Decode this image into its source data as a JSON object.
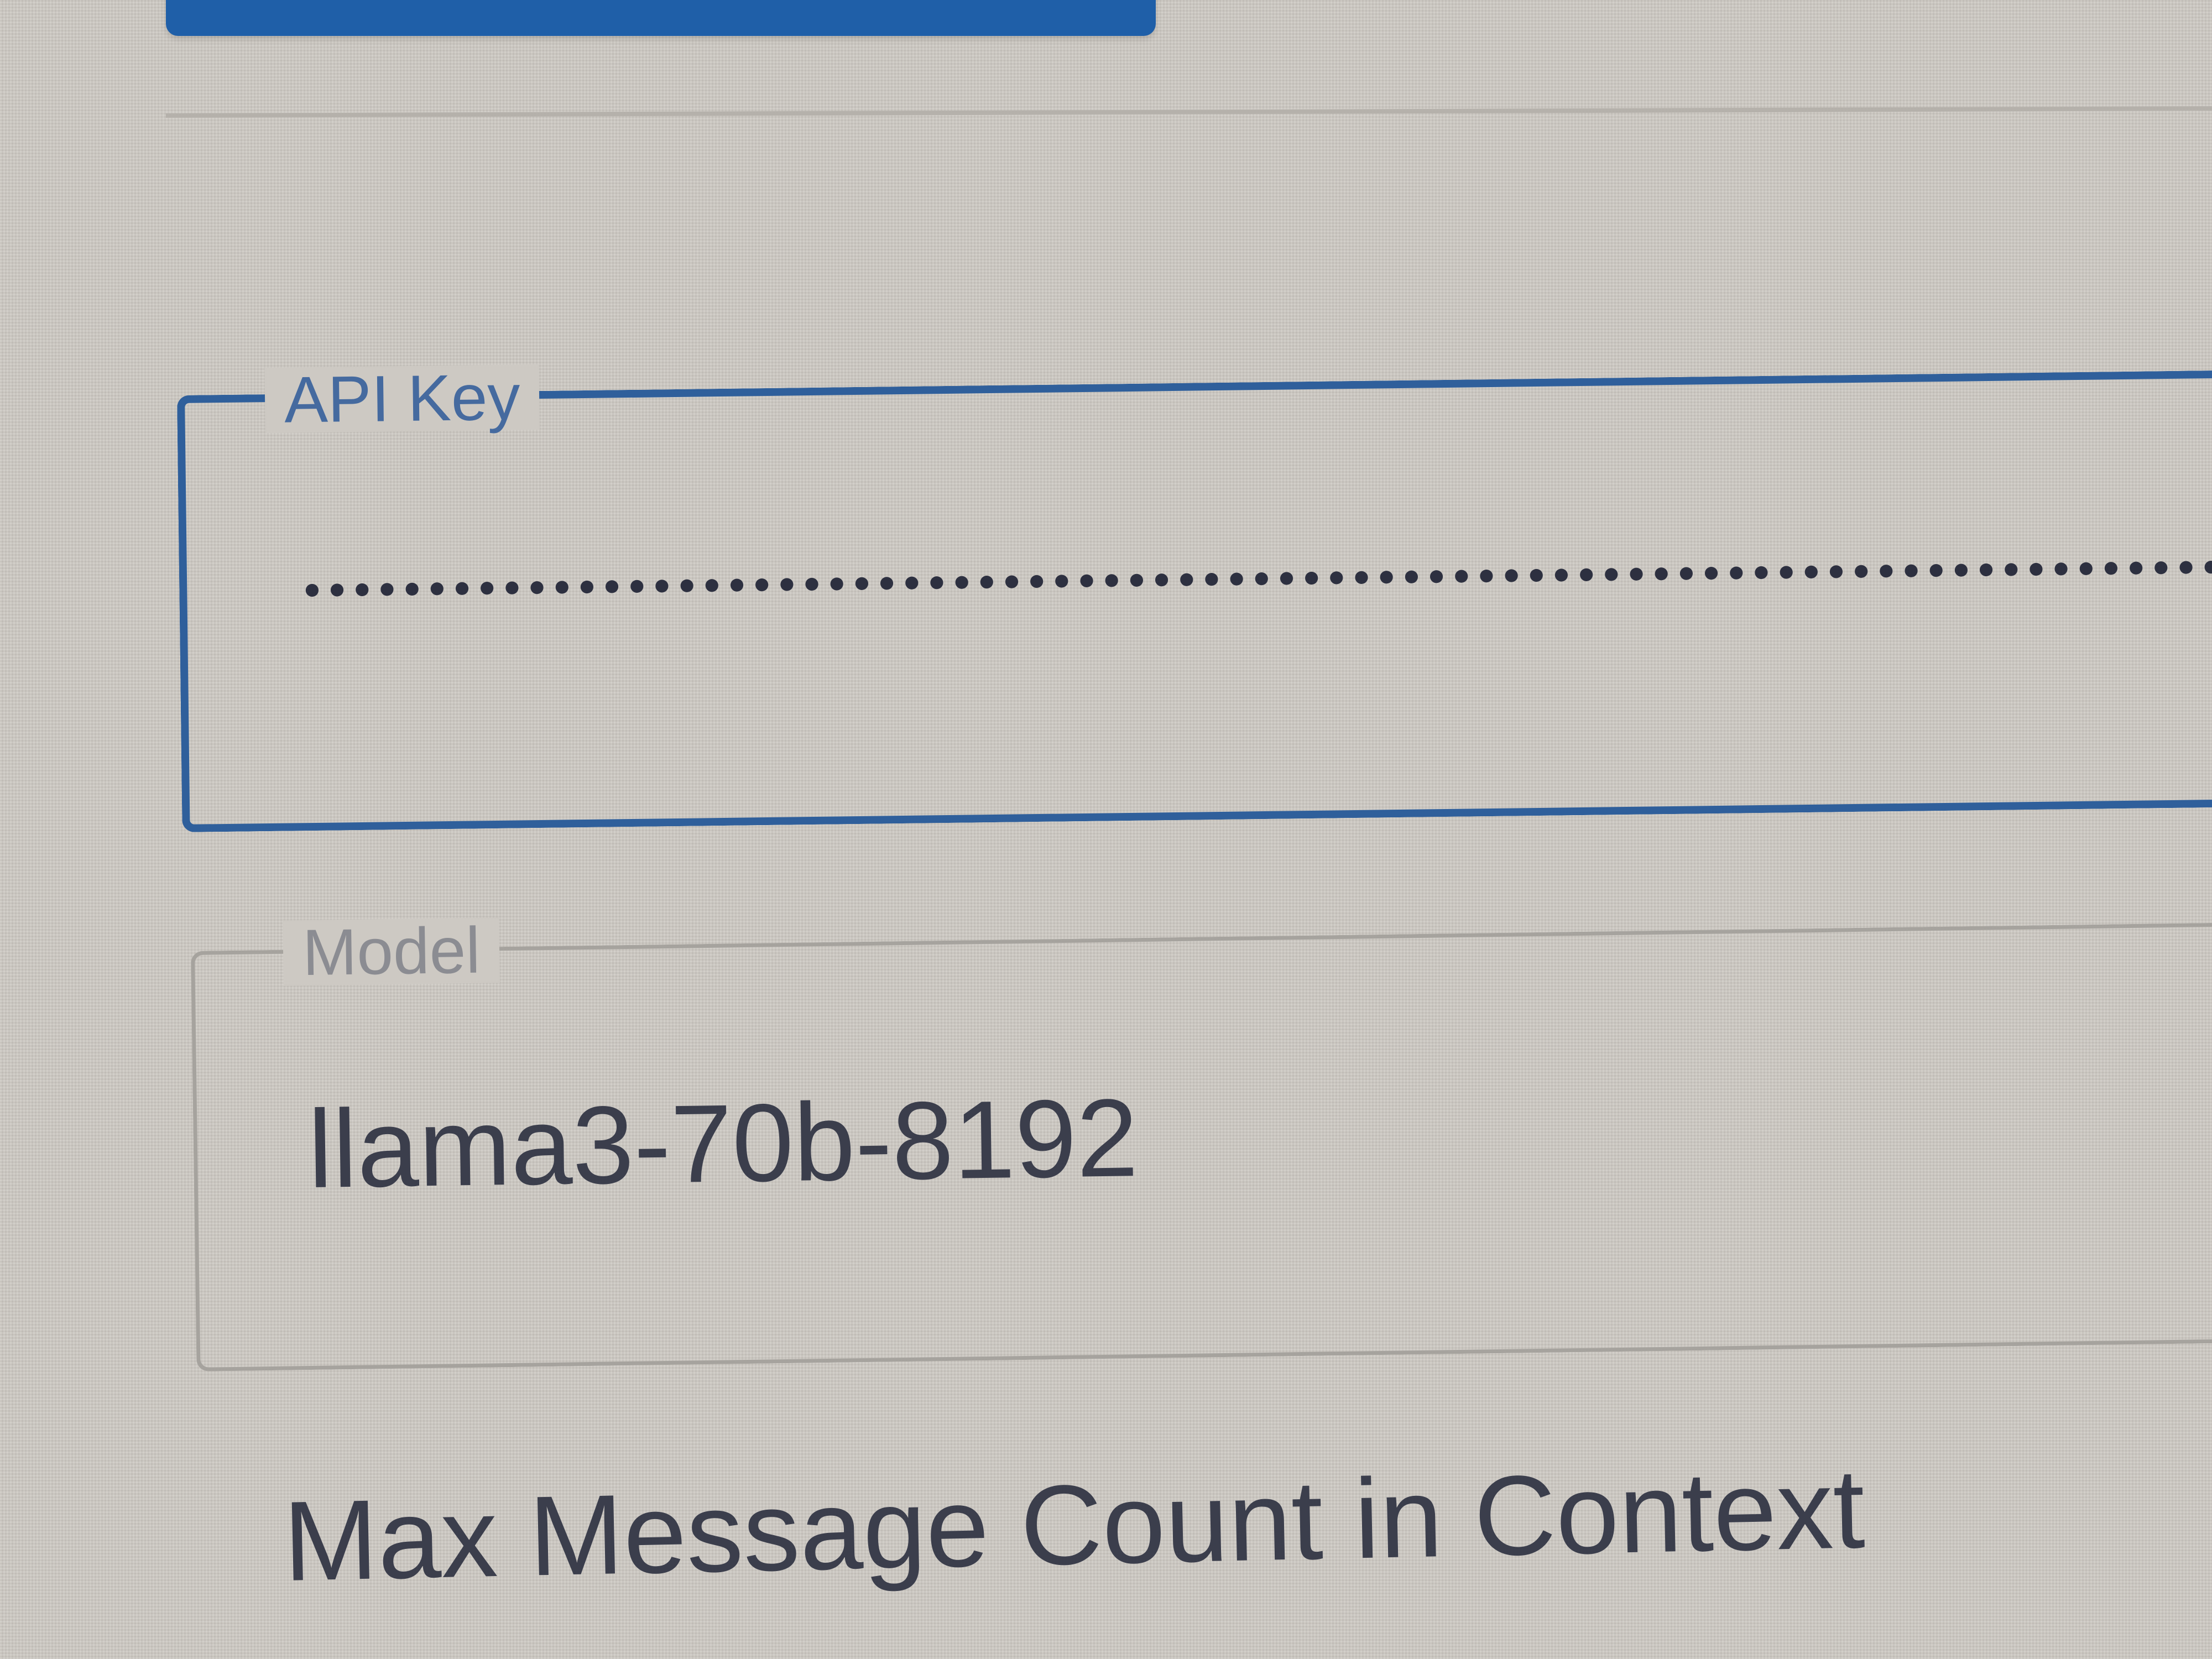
{
  "api_key": {
    "label": "API Key",
    "value": "•••••••••••••••••••••••••••••••••••••••••••••••••••••••••••••••••••••••••••••••••••••"
  },
  "model": {
    "label": "Model",
    "value": "llama3-70b-8192"
  },
  "max_message_count": {
    "label": "Max Message Count in Context"
  },
  "colors": {
    "accent": "#2f5f9b",
    "button": "#1f5fa8",
    "background": "#cdc9c3"
  }
}
